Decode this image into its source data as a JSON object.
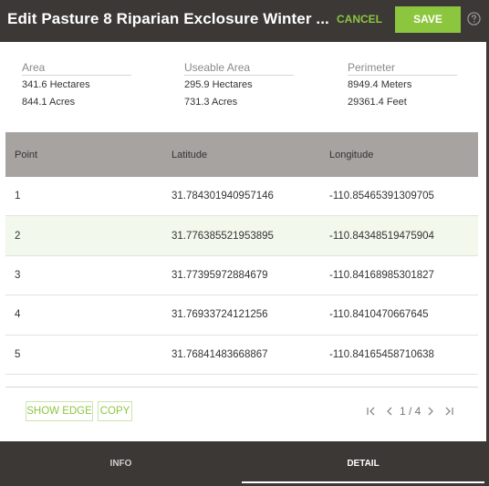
{
  "header": {
    "title": "Edit Pasture 8 Riparian Exclosure Winter ...",
    "cancel_label": "CANCEL",
    "save_label": "SAVE",
    "help_icon": "help-circle-icon"
  },
  "stats": {
    "area": {
      "label": "Area",
      "line1": "341.6 Hectares",
      "line2": "844.1 Acres"
    },
    "useable": {
      "label": "Useable Area",
      "line1": "295.9 Hectares",
      "line2": "731.3 Acres"
    },
    "perimeter": {
      "label": "Perimeter",
      "line1": "8949.4 Meters",
      "line2": "29361.4 Feet"
    }
  },
  "table": {
    "headers": [
      "Point",
      "Latitude",
      "Longitude"
    ],
    "rows": [
      [
        "1",
        "31.784301940957146",
        "-110.85465391309705"
      ],
      [
        "2",
        "31.776385521953895",
        "-110.84348519475904"
      ],
      [
        "3",
        "31.77395972884679",
        "-110.84168985301827"
      ],
      [
        "4",
        "31.76933724121256",
        "-110.8410470667645"
      ],
      [
        "5",
        "31.76841483668867",
        "-110.84165458710638"
      ]
    ]
  },
  "actions": {
    "show_edge_label": "SHOW EDGE",
    "copy_label": "COPY"
  },
  "pager": {
    "text": "1 / 4",
    "icons": [
      "first-page-icon",
      "prev-page-icon",
      "next-page-icon",
      "last-page-icon"
    ]
  },
  "tabs": {
    "info": "INFO",
    "detail": "DETAIL",
    "active": "DETAIL"
  },
  "colors": {
    "accent": "#8cc63f",
    "header_bg": "#3b3836",
    "table_header_bg": "#a7a3a1",
    "highlight_row": "#f2f8ec"
  }
}
